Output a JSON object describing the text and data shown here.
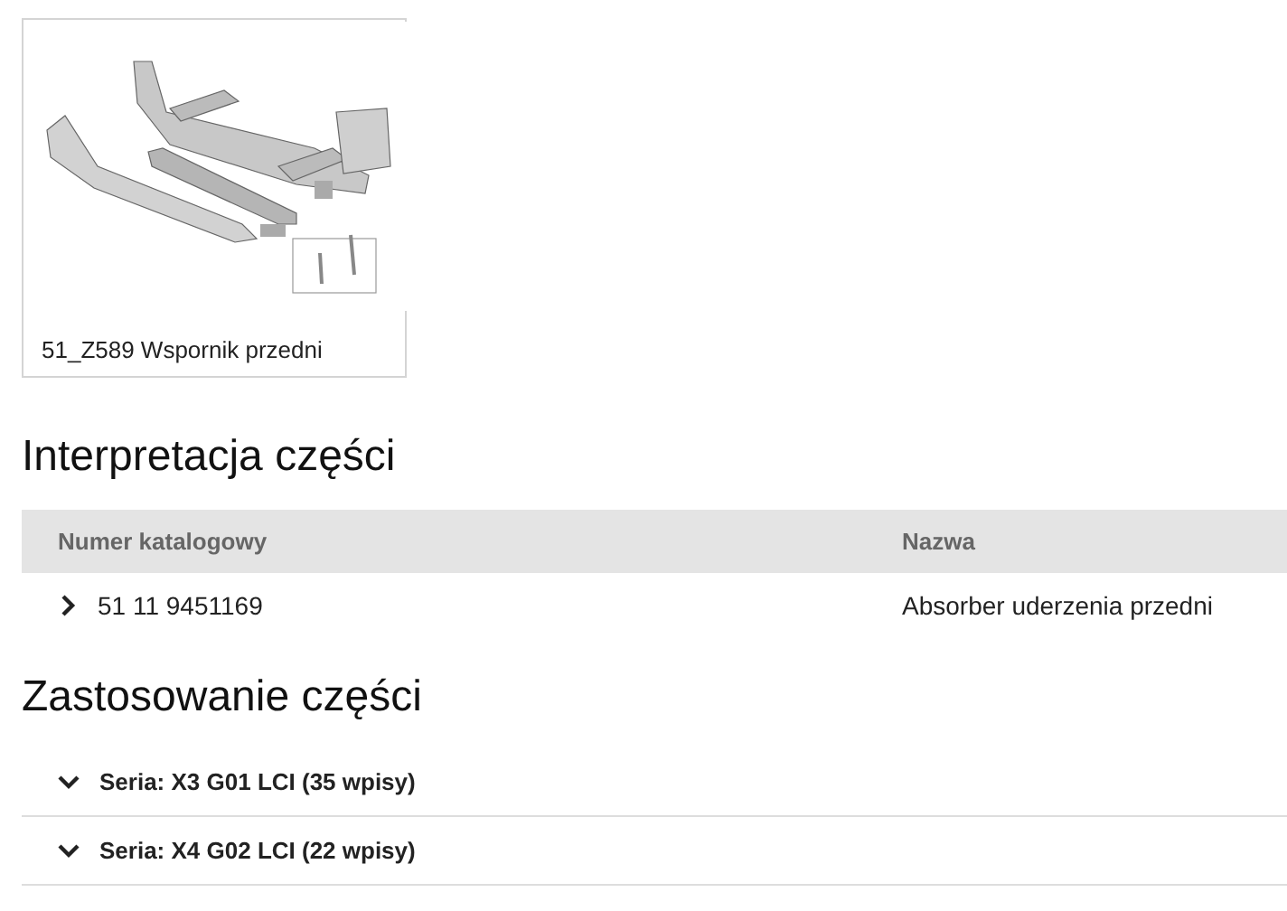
{
  "diagram": {
    "kind": "picture",
    "caption": "51_Z589 Wspornik przedni"
  },
  "interpretation": {
    "title": "Interpretacja części",
    "columns": [
      "Numer katalogowy",
      "Nazwa"
    ],
    "rows": [
      {
        "number": "51 11 9451169",
        "name": "Absorber uderzenia przedni",
        "expanded": false
      }
    ]
  },
  "usage": {
    "title": "Zastosowanie części",
    "series": [
      {
        "label": "Seria: X3 G01 LCI (35 wpisy)",
        "expanded": false
      },
      {
        "label": "Seria: X4 G02 LCI (22 wpisy)",
        "expanded": false
      }
    ]
  }
}
